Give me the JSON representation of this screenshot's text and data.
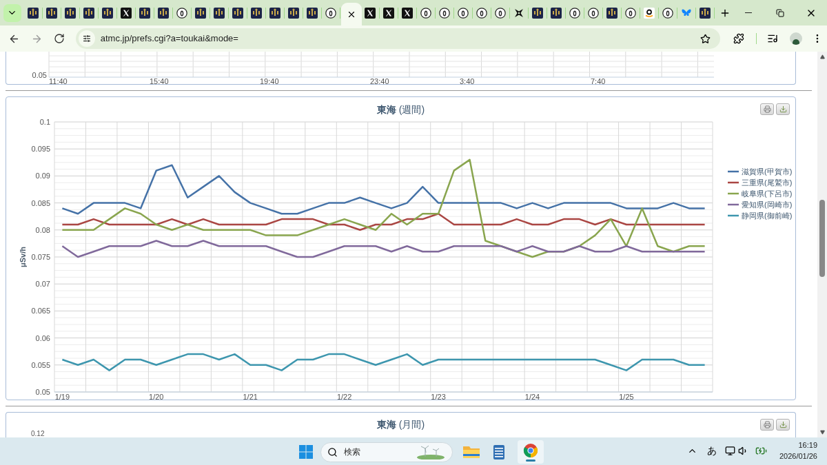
{
  "browser": {
    "tabs": [
      {
        "kind": "logo",
        "selected": false
      },
      {
        "kind": "logo",
        "selected": false
      },
      {
        "kind": "logo",
        "selected": false
      },
      {
        "kind": "logo",
        "selected": false
      },
      {
        "kind": "logo",
        "selected": false
      },
      {
        "kind": "x",
        "selected": false
      },
      {
        "kind": "logo",
        "selected": false
      },
      {
        "kind": "logo",
        "selected": false
      },
      {
        "kind": "circle",
        "selected": false
      },
      {
        "kind": "logo",
        "selected": false
      },
      {
        "kind": "logo",
        "selected": false
      },
      {
        "kind": "logo",
        "selected": false
      },
      {
        "kind": "logo",
        "selected": false
      },
      {
        "kind": "logo",
        "selected": false
      },
      {
        "kind": "logo",
        "selected": false
      },
      {
        "kind": "logo",
        "selected": false
      },
      {
        "kind": "circle",
        "selected": false
      },
      {
        "selected": true
      },
      {
        "kind": "x",
        "selected": false
      },
      {
        "kind": "x",
        "selected": false
      },
      {
        "kind": "x",
        "selected": false
      },
      {
        "kind": "circle",
        "selected": false
      },
      {
        "kind": "circle",
        "selected": false
      },
      {
        "kind": "circle",
        "selected": false
      },
      {
        "kind": "circle",
        "selected": false
      },
      {
        "kind": "circle",
        "selected": false
      },
      {
        "kind": "star",
        "selected": false
      },
      {
        "kind": "logo",
        "selected": false
      },
      {
        "kind": "logo",
        "selected": false
      },
      {
        "kind": "circle",
        "selected": false
      },
      {
        "kind": "circle",
        "selected": false
      },
      {
        "kind": "logo",
        "selected": false
      },
      {
        "kind": "circle",
        "selected": false
      },
      {
        "kind": "amazon",
        "selected": false
      },
      {
        "kind": "circle",
        "selected": false
      },
      {
        "kind": "butterfly",
        "selected": false
      },
      {
        "kind": "logo",
        "selected": false
      }
    ],
    "url": "atmc.jp/prefs.cgi?a=toukai&mode="
  },
  "top_chart": {
    "y_tick": "0.05",
    "x_ticks": [
      "11:40",
      "15:40",
      "19:40",
      "23:40",
      "3:40",
      "7:40"
    ]
  },
  "weekly_chart": {
    "title": "**東海** (週間)",
    "chart_data": {
      "type": "line",
      "ylabel": "μSv/h",
      "grid": true,
      "legend": "right",
      "categories": [
        "1/19",
        null,
        null,
        null,
        null,
        null,
        "1/20",
        null,
        null,
        null,
        null,
        null,
        "1/21",
        null,
        null,
        null,
        null,
        null,
        "1/22",
        null,
        null,
        null,
        null,
        null,
        "1/23",
        null,
        null,
        null,
        null,
        null,
        "1/24",
        null,
        null,
        null,
        null,
        null,
        "1/25",
        null,
        null,
        null,
        null,
        null
      ],
      "ylim": [
        0.05,
        0.1
      ],
      "yticks": [
        0.1,
        0.095,
        0.09,
        0.085,
        0.08,
        0.075,
        0.07,
        0.065,
        0.06,
        0.055,
        0.05
      ],
      "series": [
        {
          "name": "滋賀県(甲賀市)",
          "color": "#4572a7",
          "values": [
            0.084,
            0.083,
            0.085,
            0.085,
            0.085,
            0.084,
            0.091,
            0.092,
            0.086,
            0.088,
            0.09,
            0.087,
            0.085,
            0.084,
            0.083,
            0.083,
            0.084,
            0.085,
            0.085,
            0.086,
            0.085,
            0.084,
            0.085,
            0.088,
            0.085,
            0.085,
            0.085,
            0.085,
            0.085,
            0.084,
            0.085,
            0.084,
            0.085,
            0.085,
            0.085,
            0.085,
            0.084,
            0.084,
            0.084,
            0.085,
            0.084,
            0.084
          ]
        },
        {
          "name": "三重県(尾鷲市)",
          "color": "#aa4643",
          "values": [
            0.081,
            0.081,
            0.082,
            0.081,
            0.081,
            0.081,
            0.081,
            0.082,
            0.081,
            0.082,
            0.081,
            0.081,
            0.081,
            0.081,
            0.082,
            0.082,
            0.082,
            0.081,
            0.081,
            0.08,
            0.081,
            0.081,
            0.082,
            0.082,
            0.083,
            0.081,
            0.081,
            0.081,
            0.081,
            0.082,
            0.081,
            0.081,
            0.082,
            0.082,
            0.081,
            0.082,
            0.081,
            0.081,
            0.081,
            0.081,
            0.081,
            0.081
          ]
        },
        {
          "name": "岐阜県(下呂市)",
          "color": "#89a54e",
          "values": [
            0.08,
            0.08,
            0.08,
            0.082,
            0.084,
            0.083,
            0.081,
            0.08,
            0.081,
            0.08,
            0.08,
            0.08,
            0.08,
            0.079,
            0.079,
            0.079,
            0.08,
            0.081,
            0.082,
            0.081,
            0.08,
            0.083,
            0.081,
            0.083,
            0.083,
            0.091,
            0.093,
            0.078,
            0.077,
            0.076,
            0.075,
            0.076,
            0.076,
            0.077,
            0.079,
            0.082,
            0.077,
            0.084,
            0.077,
            0.076,
            0.077,
            0.077
          ]
        },
        {
          "name": "愛知県(岡崎市)",
          "color": "#80699b",
          "values": [
            0.077,
            0.075,
            0.076,
            0.077,
            0.077,
            0.077,
            0.078,
            0.077,
            0.077,
            0.078,
            0.077,
            0.077,
            0.077,
            0.077,
            0.076,
            0.075,
            0.075,
            0.076,
            0.077,
            0.077,
            0.077,
            0.076,
            0.077,
            0.076,
            0.076,
            0.077,
            0.077,
            0.077,
            0.077,
            0.076,
            0.077,
            0.076,
            0.076,
            0.077,
            0.076,
            0.076,
            0.077,
            0.076,
            0.076,
            0.076,
            0.076,
            0.076
          ]
        },
        {
          "name": "静岡県(御前崎)",
          "color": "#3d96ae",
          "values": [
            0.056,
            0.055,
            0.056,
            0.054,
            0.056,
            0.056,
            0.055,
            0.056,
            0.057,
            0.057,
            0.056,
            0.057,
            0.055,
            0.055,
            0.054,
            0.056,
            0.056,
            0.057,
            0.057,
            0.056,
            0.055,
            0.056,
            0.057,
            0.055,
            0.056,
            0.056,
            0.056,
            0.056,
            0.056,
            0.056,
            0.056,
            0.056,
            0.056,
            0.056,
            0.056,
            0.055,
            0.054,
            0.056,
            0.056,
            0.056,
            0.055,
            0.055
          ]
        }
      ]
    }
  },
  "monthly_chart": {
    "title": "**東海** (月間)",
    "y_tick": "0.12"
  },
  "taskbar": {
    "search_placeholder": "検索",
    "ime": "あ",
    "time": "16:19",
    "date": "2026/01/26"
  }
}
